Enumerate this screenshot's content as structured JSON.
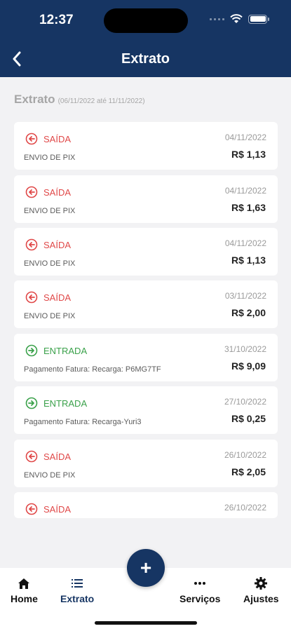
{
  "status": {
    "time": "12:37"
  },
  "header": {
    "title": "Extrato"
  },
  "heading": {
    "title": "Extrato",
    "range": "(06/11/2022 até 11/11/2022)"
  },
  "transactions": [
    {
      "type": "SAÍDA",
      "direction": "out",
      "description": "ENVIO DE PIX",
      "date": "04/11/2022",
      "amount": "R$ 1,13"
    },
    {
      "type": "SAÍDA",
      "direction": "out",
      "description": "ENVIO DE PIX",
      "date": "04/11/2022",
      "amount": "R$ 1,63"
    },
    {
      "type": "SAÍDA",
      "direction": "out",
      "description": "ENVIO DE PIX",
      "date": "04/11/2022",
      "amount": "R$ 1,13"
    },
    {
      "type": "SAÍDA",
      "direction": "out",
      "description": "ENVIO DE PIX",
      "date": "03/11/2022",
      "amount": "R$ 2,00"
    },
    {
      "type": "ENTRADA",
      "direction": "in",
      "description": "Pagamento Fatura: Recarga: P6MG7TF",
      "date": "31/10/2022",
      "amount": "R$ 9,09"
    },
    {
      "type": "ENTRADA",
      "direction": "in",
      "description": "Pagamento Fatura: Recarga-Yuri3",
      "date": "27/10/2022",
      "amount": "R$ 0,25"
    },
    {
      "type": "SAÍDA",
      "direction": "out",
      "description": "ENVIO DE PIX",
      "date": "26/10/2022",
      "amount": "R$ 2,05"
    },
    {
      "type": "SAÍDA",
      "direction": "out",
      "description": "",
      "date": "26/10/2022",
      "amount": ""
    }
  ],
  "tabbar": {
    "home": "Home",
    "extrato": "Extrato",
    "fab_symbol": "+",
    "servicos": "Serviços",
    "ajustes": "Ajustes"
  },
  "colors": {
    "primary": "#163563",
    "out": "#e04848",
    "in": "#3aa14a"
  }
}
